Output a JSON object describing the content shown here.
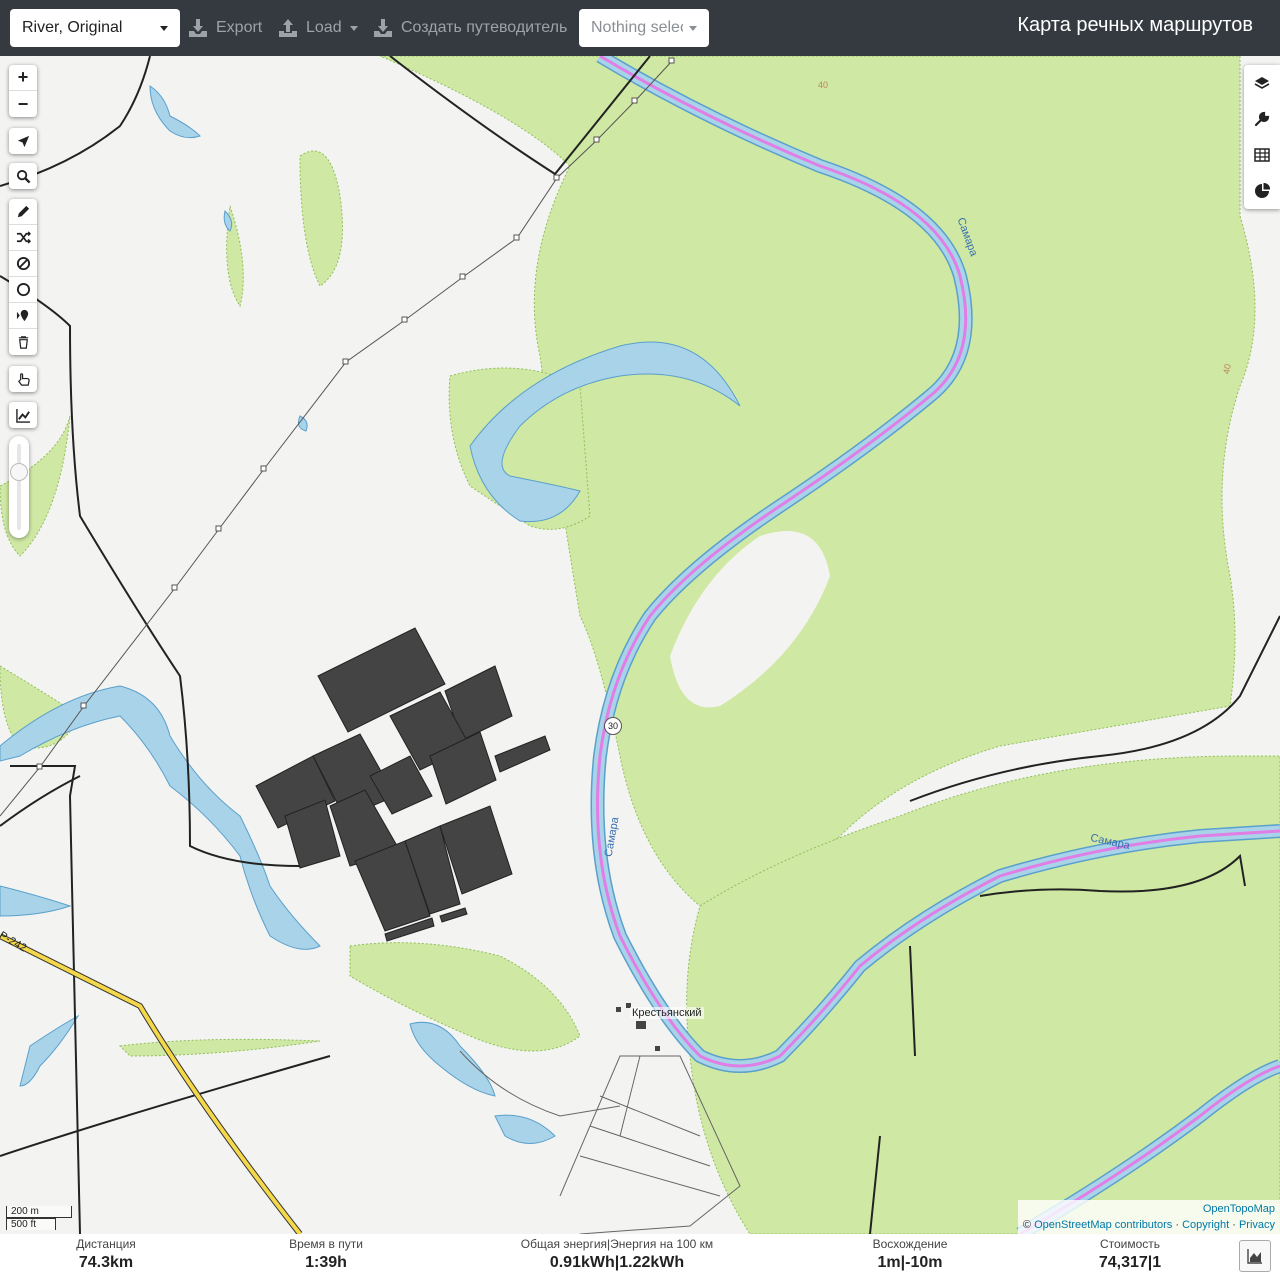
{
  "header": {
    "profile_value": "River, Original",
    "export_label": "Export",
    "load_label": "Load",
    "guide_label": "Создать путеводитель",
    "selection_value": "Nothing selected",
    "app_title": "Карта речных маршрутов"
  },
  "map": {
    "labels": {
      "village": "Крестьянский",
      "river_1": "Самара",
      "river_2": "Самара",
      "river_3": "Самара",
      "road_ref": "30",
      "road_label": "Р-242",
      "contour_40a": "40",
      "contour_40b": "40"
    },
    "scale": {
      "metric": "200 m",
      "imperial": "500 ft"
    },
    "attribution": {
      "tiles": "OpenTopoMap",
      "copy_symbol": "©",
      "osm": "OpenStreetMap contributors",
      "sep1": "·",
      "copyright": "Copyright",
      "sep2": "·",
      "privacy": "Privacy"
    },
    "icons": {
      "zoom_in": "+",
      "zoom_out": "−"
    }
  },
  "stats": {
    "distance": {
      "label": "Дистанция",
      "value": "74.3",
      "unit": "km"
    },
    "time": {
      "label": "Время в пути",
      "value": "1:39",
      "unit": "h"
    },
    "energy": {
      "label": "Общая энергия|Энергия на 100 км",
      "value1": "0.91",
      "unit1": "kWh",
      "sep": "|",
      "value2": "1.22",
      "unit2": "kWh"
    },
    "ascent": {
      "label": "Восхождение",
      "value1": "1",
      "unit1": "m",
      "sep": "|",
      "value2": "-10",
      "unit2": "m"
    },
    "cost": {
      "label": "Стоимость",
      "value": "74,317",
      "sep": "|",
      "value2": "1"
    }
  }
}
